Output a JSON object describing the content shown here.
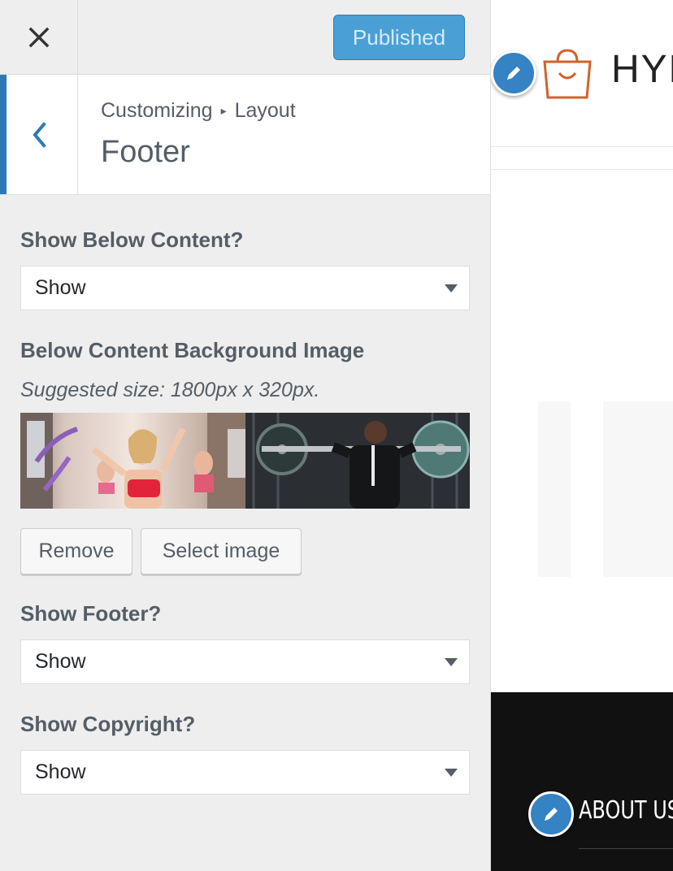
{
  "topbar": {
    "close_icon": "close-icon",
    "publish_label": "Published",
    "accent": "#4a9fd5"
  },
  "section": {
    "back_icon": "chevron-left-icon",
    "breadcrumb_root": "Customizing",
    "breadcrumb_separator_icon": "caret-right-icon",
    "breadcrumb_parent": "Layout",
    "title": "Footer"
  },
  "controls": {
    "below_content": {
      "label": "Show Below Content?",
      "value": "Show"
    },
    "bg_image": {
      "label": "Below Content Background Image",
      "description": "Suggested size: 1800px x 320px.",
      "remove_label": "Remove",
      "select_label": "Select image"
    },
    "show_footer": {
      "label": "Show Footer?",
      "value": "Show"
    },
    "show_copyright": {
      "label": "Show Copyright?",
      "value": "Show"
    }
  },
  "preview": {
    "brand_text": "HYP",
    "logo_icon": "shopping-bag-icon",
    "edit_icon": "pencil-icon",
    "footer_heading": "ABOUT US",
    "logo_color": "#d2622a",
    "footer_bg": "#111111"
  }
}
